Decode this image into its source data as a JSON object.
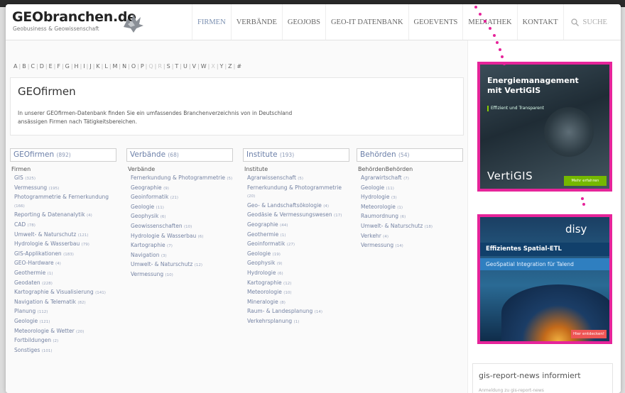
{
  "header": {
    "logo_title": "GEObranchen.de",
    "logo_sub": "Geobusiness & Geowissenschaft",
    "nav": [
      "FIRMEN",
      "VERBÄNDE",
      "GEOJOBS",
      "GEO-IT DATENBANK",
      "GEOEVENTS",
      "MEDIATHEK",
      "KONTAKT"
    ],
    "search_label": "SUCHE"
  },
  "alphabet": [
    "A",
    "B",
    "C",
    "D",
    "E",
    "F",
    "G",
    "H",
    "I",
    "J",
    "K",
    "L",
    "M",
    "N",
    "O",
    "P",
    "Q",
    "R",
    "S",
    "T",
    "U",
    "V",
    "W",
    "X",
    "Y",
    "Z",
    "#"
  ],
  "intro": {
    "title": "GEOfirmen",
    "text": "In unserer GEOfirmen-Datenbank finden Sie ein umfassendes Branchenverzeichnis von in Deutschland ansässigen Firmen nach Tätigkeitsbereichen."
  },
  "columns": [
    {
      "title": "GEOfirmen",
      "count": "(892)",
      "sub": "Firmen",
      "items": [
        {
          "label": "GIS",
          "count": "(325)"
        },
        {
          "label": "Vermessung",
          "count": "(195)"
        },
        {
          "label": "Photogrammetrie & Fernerkundung",
          "count": "(166)"
        },
        {
          "label": "Reporting & Datenanalytik",
          "count": "(4)"
        },
        {
          "label": "CAD",
          "count": "(78)"
        },
        {
          "label": "Umwelt- & Naturschutz",
          "count": "(121)"
        },
        {
          "label": "Hydrologie & Wasserbau",
          "count": "(79)"
        },
        {
          "label": "GIS-Applikationen",
          "count": "(183)"
        },
        {
          "label": "GEO-Hardware",
          "count": "(4)"
        },
        {
          "label": "Geothermie",
          "count": "(1)"
        },
        {
          "label": "Geodaten",
          "count": "(228)"
        },
        {
          "label": "Kartographie & Visualisierung",
          "count": "(141)"
        },
        {
          "label": "Navigation & Telematik",
          "count": "(82)"
        },
        {
          "label": "Planung",
          "count": "(112)"
        },
        {
          "label": "Geologie",
          "count": "(121)"
        },
        {
          "label": "Meteorologie & Wetter",
          "count": "(20)"
        },
        {
          "label": "Fortbildungen",
          "count": "(2)"
        },
        {
          "label": "Sonstiges",
          "count": "(101)"
        }
      ]
    },
    {
      "title": "Verbände",
      "count": "(68)",
      "sub": "Verbände",
      "items": [
        {
          "label": "Fernerkundung & Photogrammetrie",
          "count": "(5)"
        },
        {
          "label": "Geographie",
          "count": "(9)"
        },
        {
          "label": "Geoinformatik",
          "count": "(21)"
        },
        {
          "label": "Geologie",
          "count": "(11)"
        },
        {
          "label": "Geophysik",
          "count": "(6)"
        },
        {
          "label": "Geowissenschaften",
          "count": "(10)"
        },
        {
          "label": "Hydrologie & Wasserbau",
          "count": "(6)"
        },
        {
          "label": "Kartographie",
          "count": "(7)"
        },
        {
          "label": "Navigation",
          "count": "(3)"
        },
        {
          "label": "Umwelt- & Naturschutz",
          "count": "(12)"
        },
        {
          "label": "Vermessung",
          "count": "(10)"
        }
      ]
    },
    {
      "title": "Institute",
      "count": "(193)",
      "sub": "Institute",
      "items": [
        {
          "label": "Agrarwissenschaft",
          "count": "(5)"
        },
        {
          "label": "Fernerkundung & Photogrammetrie",
          "count": "(20)"
        },
        {
          "label": "Geo- & Landschaftsökologie",
          "count": "(4)"
        },
        {
          "label": "Geodäsie & Vermessungswesen",
          "count": "(17)"
        },
        {
          "label": "Geographie",
          "count": "(44)"
        },
        {
          "label": "Geothermie",
          "count": "(1)"
        },
        {
          "label": "Geoinformatik",
          "count": "(27)"
        },
        {
          "label": "Geologie",
          "count": "(19)"
        },
        {
          "label": "Geophysik",
          "count": "(9)"
        },
        {
          "label": "Hydrologie",
          "count": "(6)"
        },
        {
          "label": "Kartographie",
          "count": "(12)"
        },
        {
          "label": "Meteorologie",
          "count": "(10)"
        },
        {
          "label": "Mineralogie",
          "count": "(8)"
        },
        {
          "label": "Raum- & Landesplanung",
          "count": "(14)"
        },
        {
          "label": "Verkehrsplanung",
          "count": "(1)"
        }
      ]
    },
    {
      "title": "Behörden",
      "count": "(54)",
      "sub": "BehördenBehörden",
      "items": [
        {
          "label": "Agrarwirtschaft",
          "count": "(7)"
        },
        {
          "label": "Geologie",
          "count": "(11)"
        },
        {
          "label": "Hydrologie",
          "count": "(3)"
        },
        {
          "label": "Meteorologie",
          "count": "(1)"
        },
        {
          "label": "Raumordnung",
          "count": "(6)"
        },
        {
          "label": "Umwelt- & Naturschutz",
          "count": "(18)"
        },
        {
          "label": "Verkehr",
          "count": "(4)"
        },
        {
          "label": "Vermessung",
          "count": "(14)"
        }
      ]
    }
  ],
  "ads": {
    "vertigis": {
      "title": "Energiemanagement mit VertiGIS",
      "sub": "Effizient und Transparent",
      "brand": "VertiGIS",
      "cta": "Mehr erfahren"
    },
    "disy": {
      "brand": "disy",
      "headline": "Effizientes Spatial-ETL",
      "subline": "GeoSpatial Integration für Talend",
      "cta": "Hier entdecken!"
    }
  },
  "news": {
    "title": "gis-report-news informiert",
    "text": "Anmeldung zu gis-report-news"
  },
  "colors": {
    "accent": "#e6249a",
    "link": "#7583a3",
    "heading": "#6b7fa8"
  }
}
